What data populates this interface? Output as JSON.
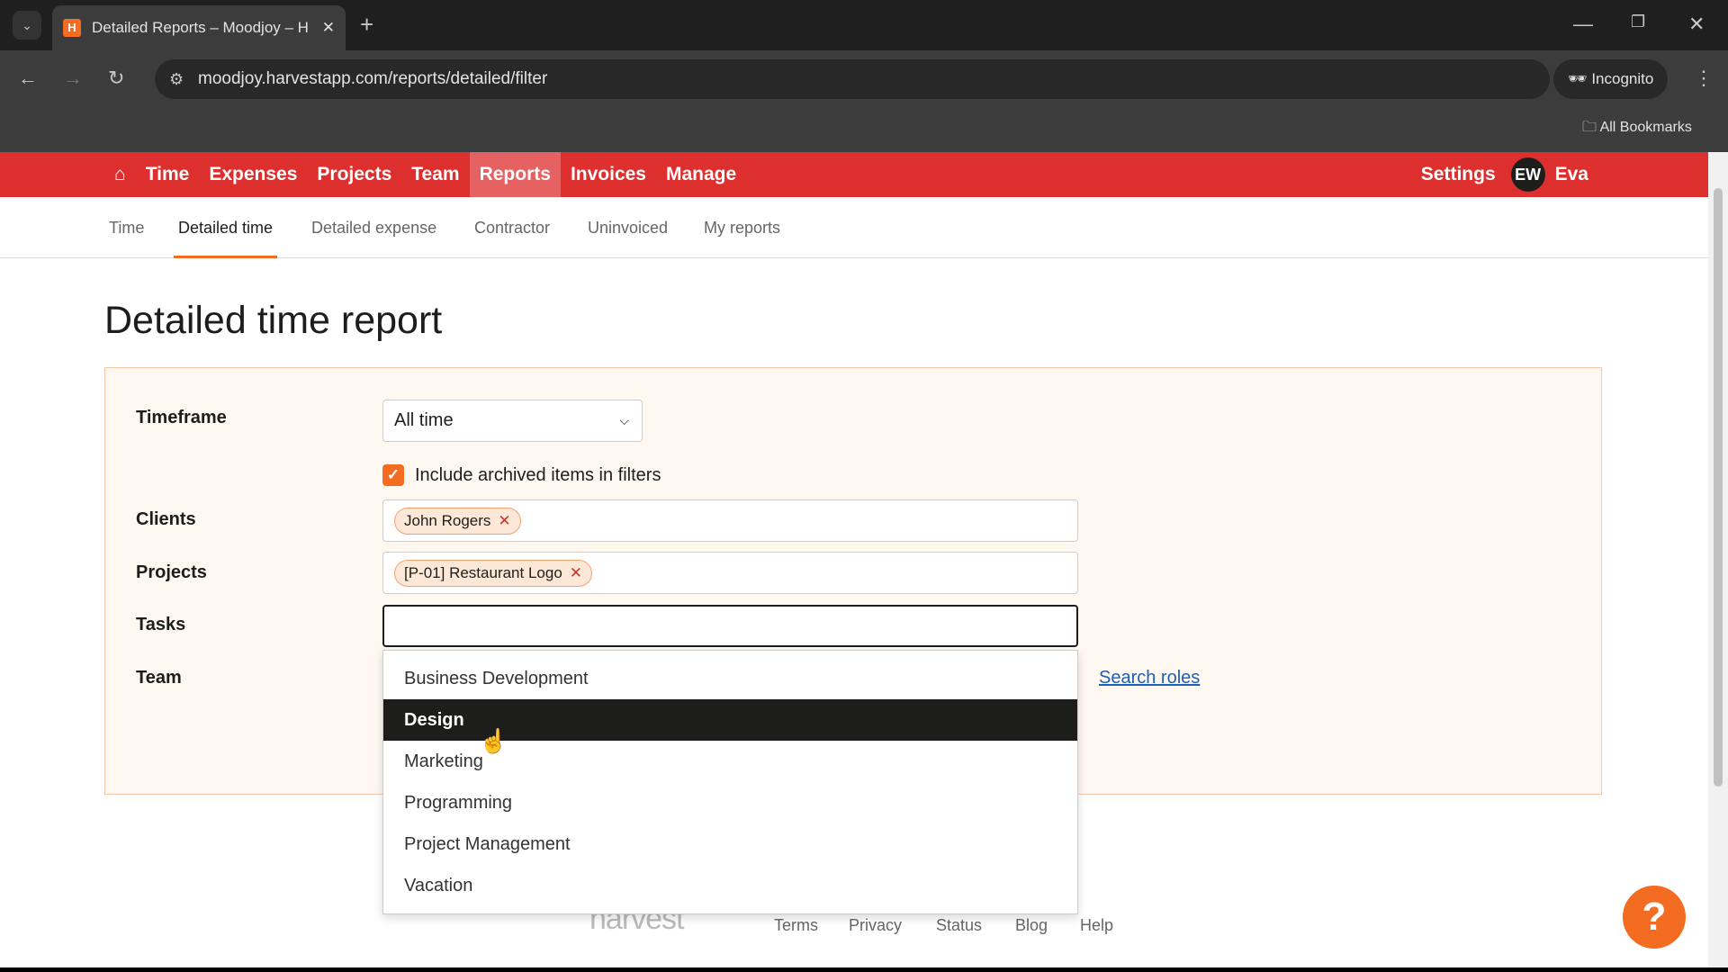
{
  "browser": {
    "tab_title": "Detailed Reports – Moodjoy – H",
    "url": "moodjoy.harvestapp.com/reports/detailed/filter",
    "incognito": "Incognito",
    "bookmarks": "All Bookmarks"
  },
  "nav": {
    "items": [
      "Time",
      "Expenses",
      "Projects",
      "Team",
      "Reports",
      "Invoices",
      "Manage"
    ],
    "active": "Reports",
    "settings": "Settings",
    "avatar": "EW",
    "user": "Eva",
    "brand_color": "#de2f2f"
  },
  "subnav": {
    "items": [
      "Time",
      "Detailed time",
      "Detailed expense",
      "Contractor",
      "Uninvoiced",
      "My reports"
    ],
    "active": "Detailed time"
  },
  "page": {
    "title": "Detailed time report"
  },
  "filters": {
    "timeframe_label": "Timeframe",
    "timeframe_value": "All time",
    "archived_label": "Include archived items in filters",
    "archived_checked": true,
    "clients_label": "Clients",
    "clients": [
      "John Rogers"
    ],
    "projects_label": "Projects",
    "projects": [
      "[P-01] Restaurant Logo"
    ],
    "tasks_label": "Tasks",
    "tasks_value": "",
    "team_label": "Team",
    "search_roles": "Search roles"
  },
  "dropdown": {
    "options": [
      "Business Development",
      "Design",
      "Marketing",
      "Programming",
      "Project Management",
      "Vacation"
    ],
    "highlighted": "Design"
  },
  "footer": {
    "logo": "harvest",
    "links": [
      "Terms",
      "Privacy",
      "Status",
      "Blog",
      "Help"
    ]
  },
  "help_button": "?"
}
